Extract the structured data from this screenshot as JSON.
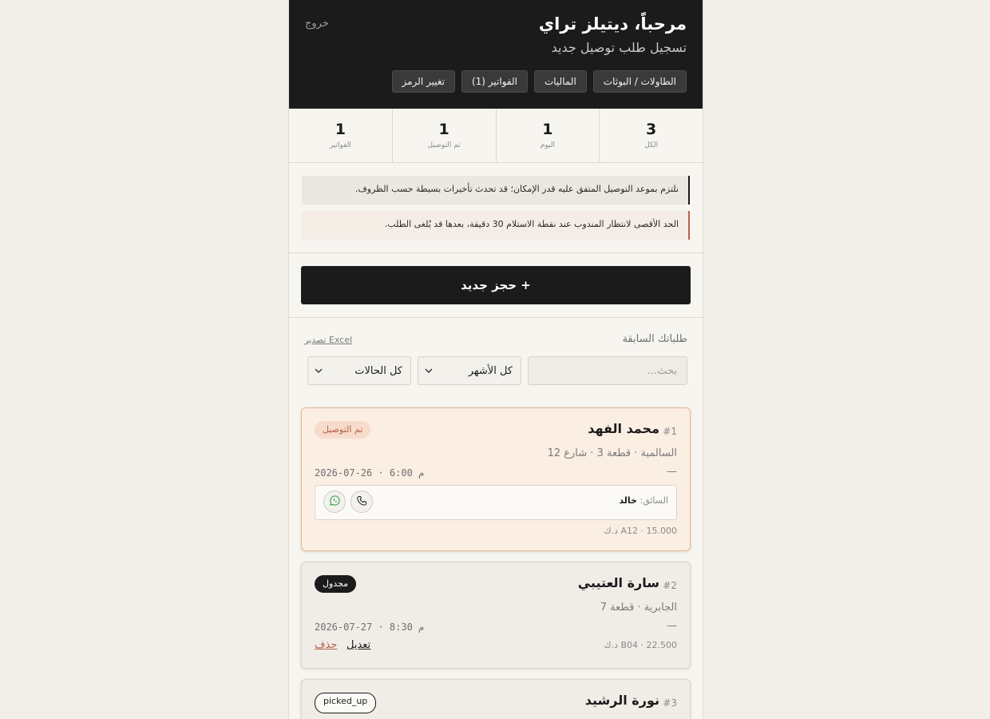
{
  "header": {
    "title": "مرحباً، ديتيلز تراي",
    "subtitle": "تسجيل طلب توصيل جديد",
    "logout": "خروج",
    "nav": [
      "الطاولات / البوثات",
      "الماليات",
      "الفواتير (1)",
      "تغيير الرمز"
    ]
  },
  "stats": [
    {
      "value": "3",
      "label": "الكل"
    },
    {
      "value": "1",
      "label": "اليوم"
    },
    {
      "value": "1",
      "label": "تم التوصيل"
    },
    {
      "value": "1",
      "label": "الفواتير"
    }
  ],
  "notices": [
    "نلتزم بموعد التوصيل المتفق عليه قدر الإمكان؛ قد تحدث تأخيرات بسيطة حسب الظروف.",
    "الحد الأقصى لانتظار المندوب عند نقطة الاستلام 30 دقيقة، بعدها قد يُلغى الطلب."
  ],
  "cta": "+ حجز جديد",
  "list": {
    "title": "طلباتك السابقة",
    "export": "تصدير Excel",
    "search_placeholder": "بحث...",
    "month_filter": "كل الأشهر",
    "status_filter": "كل الحالات"
  },
  "orders": [
    {
      "num": "#1",
      "name": "محمد الفهد",
      "status": "تم التوصيل",
      "address": "السالمية · قطعة 3 · شارع 12",
      "dash": "—",
      "datetime": "2026-07-26  ·  6:00 م",
      "driver_label": "السائق:",
      "driver_name": "خالد",
      "price": "15.000 · A12 د.ك"
    },
    {
      "num": "#2",
      "name": "سارة العتيبي",
      "status": "مجدول",
      "address": "الجابرية · قطعة 7",
      "dash": "—",
      "datetime": "2026-07-27  ·  8:30 م",
      "price": "22.500 · B04 د.ك",
      "edit": "تعديل",
      "delete": "حذف"
    },
    {
      "num": "#3",
      "name": "نورة الرشيد",
      "status": "picked_up"
    }
  ],
  "icons": {
    "phone": "phone-icon",
    "whatsapp": "whatsapp-icon",
    "chevron": "chevron-down-icon"
  },
  "colors": {
    "header_bg": "#1b1b1b",
    "accent": "#b5634a",
    "delivered_card_bg": "#fbeee3",
    "whatsapp_green": "#25a244"
  }
}
